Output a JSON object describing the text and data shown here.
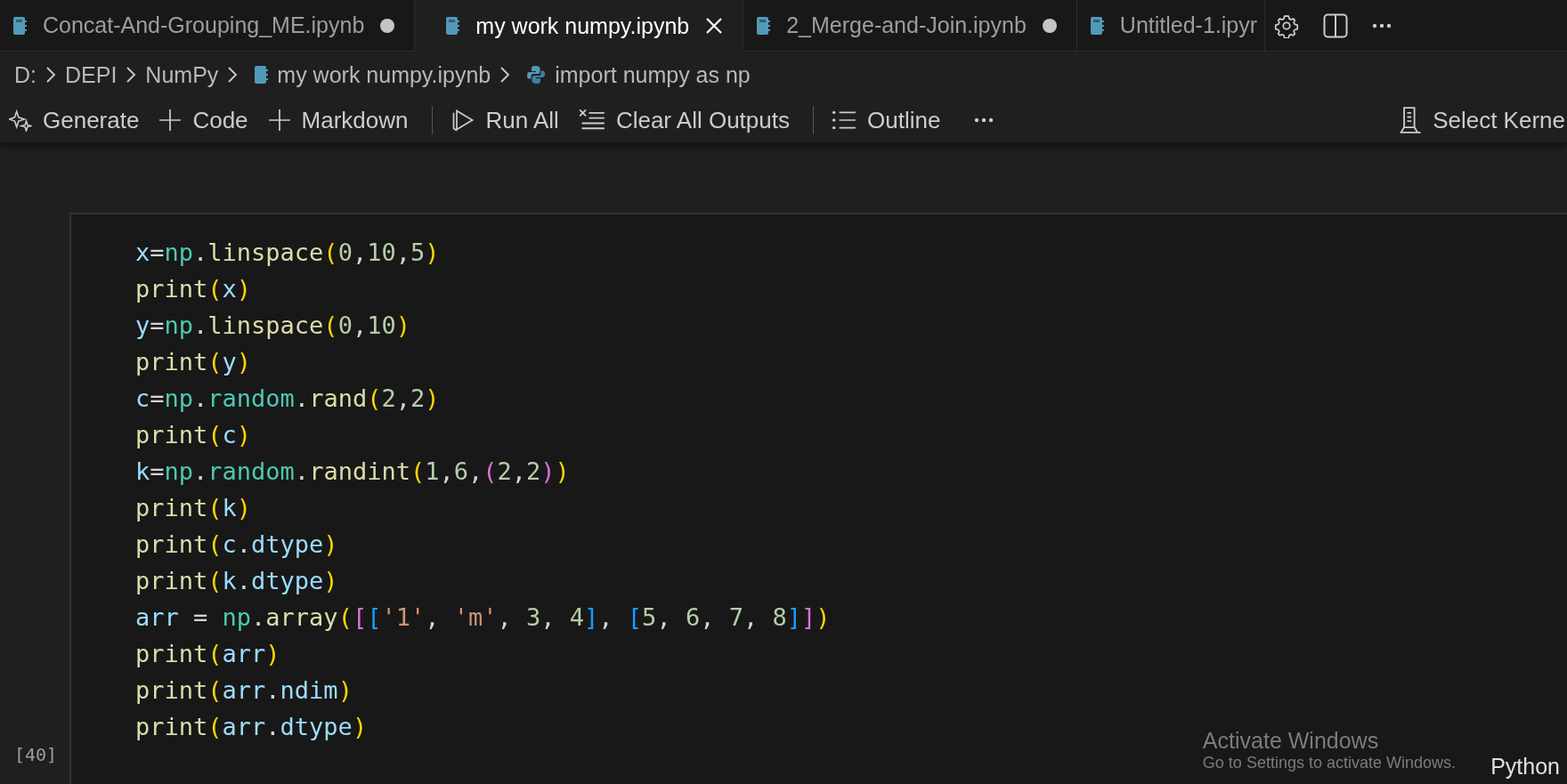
{
  "tabs": [
    {
      "label": "Concat-And-Grouping_ME.ipynb",
      "selected": false,
      "dirty": true
    },
    {
      "label": "my work numpy.ipynb",
      "selected": true,
      "dirty": false
    },
    {
      "label": "2_Merge-and-Join.ipynb",
      "selected": false,
      "dirty": true
    },
    {
      "label": "Untitled-1.ipyr",
      "selected": false,
      "dirty": false
    }
  ],
  "breadcrumbs": [
    {
      "label": "D:",
      "kind": "folder"
    },
    {
      "label": "DEPI",
      "kind": "folder"
    },
    {
      "label": "NumPy",
      "kind": "folder"
    },
    {
      "label": "my work numpy.ipynb",
      "kind": "notebook"
    },
    {
      "label": "import numpy as np",
      "kind": "python"
    }
  ],
  "toolbar": {
    "groups": [
      [
        {
          "label": "Generate",
          "kind": "sparkle"
        },
        {
          "label": "Code",
          "kind": "plus"
        },
        {
          "label": "Markdown",
          "kind": "plus"
        }
      ],
      [
        {
          "label": "Run All",
          "kind": "run"
        },
        {
          "label": "Clear All Outputs",
          "kind": "clear"
        }
      ],
      [
        {
          "label": "Outline",
          "kind": "outline"
        }
      ]
    ]
  },
  "kernel": {
    "label": "Select Kerne"
  },
  "cell": {
    "execution_count": "[40]",
    "language": "Python",
    "lines": [
      [
        {
          "text": "x",
          "kind": "var"
        },
        {
          "text": "=",
          "kind": "op"
        },
        {
          "text": "np",
          "kind": "module"
        },
        {
          "text": ".",
          "kind": "op"
        },
        {
          "text": "linspace",
          "kind": "func"
        },
        {
          "text": "(",
          "kind": "bracket1"
        },
        {
          "text": "0",
          "kind": "number"
        },
        {
          "text": ",",
          "kind": "op"
        },
        {
          "text": "10",
          "kind": "number"
        },
        {
          "text": ",",
          "kind": "op"
        },
        {
          "text": "5",
          "kind": "number"
        },
        {
          "text": ")",
          "kind": "bracket1"
        }
      ],
      [
        {
          "text": "print",
          "kind": "func"
        },
        {
          "text": "(",
          "kind": "bracket1"
        },
        {
          "text": "x",
          "kind": "var"
        },
        {
          "text": ")",
          "kind": "bracket1"
        }
      ],
      [
        {
          "text": "y",
          "kind": "var"
        },
        {
          "text": "=",
          "kind": "op"
        },
        {
          "text": "np",
          "kind": "module"
        },
        {
          "text": ".",
          "kind": "op"
        },
        {
          "text": "linspace",
          "kind": "func"
        },
        {
          "text": "(",
          "kind": "bracket1"
        },
        {
          "text": "0",
          "kind": "number"
        },
        {
          "text": ",",
          "kind": "op"
        },
        {
          "text": "10",
          "kind": "number"
        },
        {
          "text": ")",
          "kind": "bracket1"
        }
      ],
      [
        {
          "text": "print",
          "kind": "func"
        },
        {
          "text": "(",
          "kind": "bracket1"
        },
        {
          "text": "y",
          "kind": "var"
        },
        {
          "text": ")",
          "kind": "bracket1"
        }
      ],
      [
        {
          "text": "c",
          "kind": "var"
        },
        {
          "text": "=",
          "kind": "op"
        },
        {
          "text": "np",
          "kind": "module"
        },
        {
          "text": ".",
          "kind": "op"
        },
        {
          "text": "random",
          "kind": "module"
        },
        {
          "text": ".",
          "kind": "op"
        },
        {
          "text": "rand",
          "kind": "func"
        },
        {
          "text": "(",
          "kind": "bracket1"
        },
        {
          "text": "2",
          "kind": "number"
        },
        {
          "text": ",",
          "kind": "op"
        },
        {
          "text": "2",
          "kind": "number"
        },
        {
          "text": ")",
          "kind": "bracket1"
        }
      ],
      [
        {
          "text": "print",
          "kind": "func"
        },
        {
          "text": "(",
          "kind": "bracket1"
        },
        {
          "text": "c",
          "kind": "var"
        },
        {
          "text": ")",
          "kind": "bracket1"
        }
      ],
      [
        {
          "text": "k",
          "kind": "var"
        },
        {
          "text": "=",
          "kind": "op"
        },
        {
          "text": "np",
          "kind": "module"
        },
        {
          "text": ".",
          "kind": "op"
        },
        {
          "text": "random",
          "kind": "module"
        },
        {
          "text": ".",
          "kind": "op"
        },
        {
          "text": "randint",
          "kind": "func"
        },
        {
          "text": "(",
          "kind": "bracket1"
        },
        {
          "text": "1",
          "kind": "number"
        },
        {
          "text": ",",
          "kind": "op"
        },
        {
          "text": "6",
          "kind": "number"
        },
        {
          "text": ",",
          "kind": "op"
        },
        {
          "text": "(",
          "kind": "bracket2"
        },
        {
          "text": "2",
          "kind": "number"
        },
        {
          "text": ",",
          "kind": "op"
        },
        {
          "text": "2",
          "kind": "number"
        },
        {
          "text": ")",
          "kind": "bracket2"
        },
        {
          "text": ")",
          "kind": "bracket1"
        }
      ],
      [
        {
          "text": "print",
          "kind": "func"
        },
        {
          "text": "(",
          "kind": "bracket1"
        },
        {
          "text": "k",
          "kind": "var"
        },
        {
          "text": ")",
          "kind": "bracket1"
        }
      ],
      [
        {
          "text": "print",
          "kind": "func"
        },
        {
          "text": "(",
          "kind": "bracket1"
        },
        {
          "text": "c",
          "kind": "var"
        },
        {
          "text": ".",
          "kind": "op"
        },
        {
          "text": "dtype",
          "kind": "var"
        },
        {
          "text": ")",
          "kind": "bracket1"
        }
      ],
      [
        {
          "text": "print",
          "kind": "func"
        },
        {
          "text": "(",
          "kind": "bracket1"
        },
        {
          "text": "k",
          "kind": "var"
        },
        {
          "text": ".",
          "kind": "op"
        },
        {
          "text": "dtype",
          "kind": "var"
        },
        {
          "text": ")",
          "kind": "bracket1"
        }
      ],
      [
        {
          "text": "arr",
          "kind": "var"
        },
        {
          "text": " = ",
          "kind": "op"
        },
        {
          "text": "np",
          "kind": "module"
        },
        {
          "text": ".",
          "kind": "op"
        },
        {
          "text": "array",
          "kind": "func"
        },
        {
          "text": "(",
          "kind": "bracket1"
        },
        {
          "text": "[",
          "kind": "bracket2"
        },
        {
          "text": "[",
          "kind": "bracket3"
        },
        {
          "text": "'1'",
          "kind": "string"
        },
        {
          "text": ", ",
          "kind": "op"
        },
        {
          "text": "'m'",
          "kind": "string"
        },
        {
          "text": ", ",
          "kind": "op"
        },
        {
          "text": "3",
          "kind": "number"
        },
        {
          "text": ", ",
          "kind": "op"
        },
        {
          "text": "4",
          "kind": "number"
        },
        {
          "text": "]",
          "kind": "bracket3"
        },
        {
          "text": ", ",
          "kind": "op"
        },
        {
          "text": "[",
          "kind": "bracket3"
        },
        {
          "text": "5",
          "kind": "number"
        },
        {
          "text": ", ",
          "kind": "op"
        },
        {
          "text": "6",
          "kind": "number"
        },
        {
          "text": ", ",
          "kind": "op"
        },
        {
          "text": "7",
          "kind": "number"
        },
        {
          "text": ", ",
          "kind": "op"
        },
        {
          "text": "8",
          "kind": "number"
        },
        {
          "text": "]",
          "kind": "bracket3"
        },
        {
          "text": "]",
          "kind": "bracket2"
        },
        {
          "text": ")",
          "kind": "bracket1"
        }
      ],
      [
        {
          "text": "print",
          "kind": "func"
        },
        {
          "text": "(",
          "kind": "bracket1"
        },
        {
          "text": "arr",
          "kind": "var"
        },
        {
          "text": ")",
          "kind": "bracket1"
        }
      ],
      [
        {
          "text": "print",
          "kind": "func"
        },
        {
          "text": "(",
          "kind": "bracket1"
        },
        {
          "text": "arr",
          "kind": "var"
        },
        {
          "text": ".",
          "kind": "op"
        },
        {
          "text": "ndim",
          "kind": "var"
        },
        {
          "text": ")",
          "kind": "bracket1"
        }
      ],
      [
        {
          "text": "print",
          "kind": "func"
        },
        {
          "text": "(",
          "kind": "bracket1"
        },
        {
          "text": "arr",
          "kind": "var"
        },
        {
          "text": ".",
          "kind": "op"
        },
        {
          "text": "dtype",
          "kind": "var"
        },
        {
          "text": ")",
          "kind": "bracket1"
        }
      ]
    ]
  },
  "os_notice": {
    "title": "Activate Windows",
    "message": "Go to Settings to activate Windows."
  }
}
